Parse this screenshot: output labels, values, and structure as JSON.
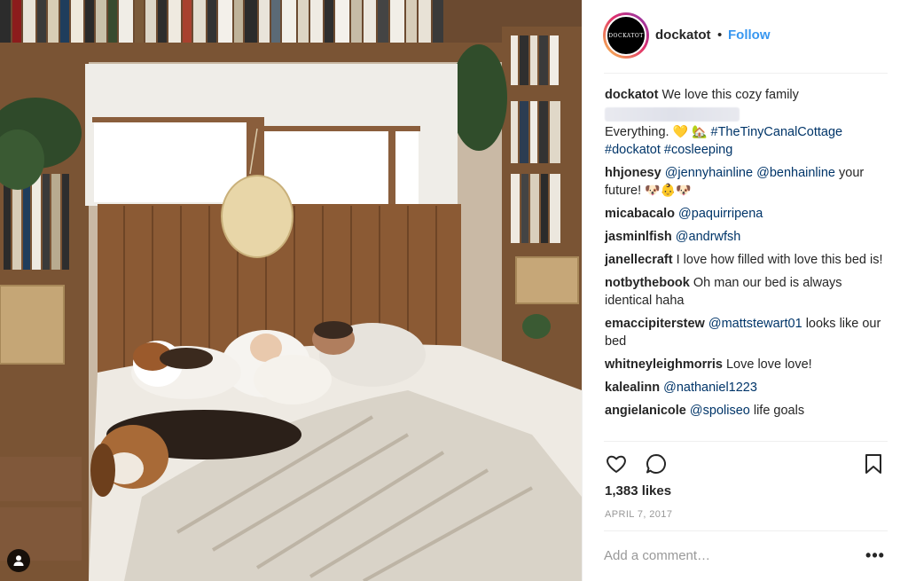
{
  "post": {
    "author": "dockatot",
    "follow_label": "Follow",
    "separator": "•",
    "avatar_text": "DOCKATOT"
  },
  "caption": {
    "username": "dockatot",
    "text_line1": "We love this cozy family",
    "text_line3_prefix": "Everything.",
    "emoji_heart": "💛",
    "emoji_house": "🏡",
    "hashtag1": "#TheTinyCanalCottage",
    "hashtag2": "#dockatot",
    "hashtag3": "#cosleeping"
  },
  "comments": [
    {
      "username": "hhjonesy",
      "mention1": "@jennyhainline",
      "mention2": "@benhainline",
      "text": "your future!",
      "emojis": "🐶👶🐶"
    },
    {
      "username": "micabacalo",
      "mention": "@paquirripena"
    },
    {
      "username": "jasminlfish",
      "mention": "@andrwfsh"
    },
    {
      "username": "janellecraft",
      "text": "I love how filled with love this bed is!"
    },
    {
      "username": "notbythebook",
      "text": "Oh man our bed is always identical haha"
    },
    {
      "username": "emaccipiterstew",
      "mention": "@mattstewart01",
      "text": "looks like our bed"
    },
    {
      "username": "whitneyleighmorris",
      "text": "Love love love!"
    },
    {
      "username": "kalealinn",
      "mention": "@nathaniel1223"
    },
    {
      "username": "angielanicole",
      "mention": "@spoliseo",
      "text": "life goals"
    }
  ],
  "stats": {
    "likes": "1,383 likes",
    "date": "APRIL 7, 2017"
  },
  "add_comment": {
    "placeholder": "Add a comment…",
    "more_label": "•••"
  },
  "icons": {
    "like": "heart-icon",
    "comment": "speech-bubble-icon",
    "save": "bookmark-icon",
    "tags": "person-tag-icon"
  }
}
